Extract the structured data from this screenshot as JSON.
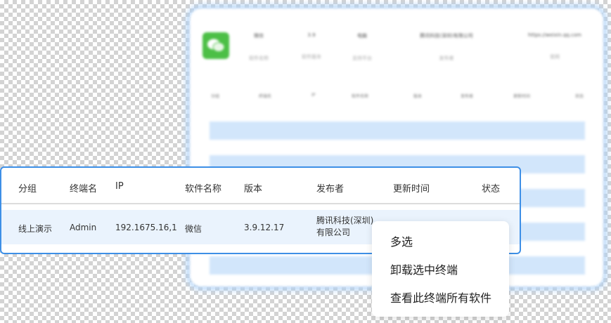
{
  "background_panel": {
    "info": [
      {
        "title": "微信",
        "sub": "软件名称"
      },
      {
        "title": "3.9",
        "sub": "软件版本"
      },
      {
        "title": "电脑",
        "sub": "支持平台"
      },
      {
        "title": "腾讯科技(深圳)有限公司",
        "sub": "发布者"
      },
      {
        "title": "https://weixin.qq.com",
        "sub": "官网"
      }
    ],
    "headers": [
      "分组",
      "终端名",
      "IP",
      "软件名称",
      "版本",
      "发布者",
      "更新时间",
      "状态"
    ]
  },
  "table": {
    "headers": [
      "分组",
      "终端名",
      "IP",
      "软件名称",
      "版本",
      "发布者",
      "更新时间",
      "状态"
    ],
    "rows": [
      {
        "group": "线上演示",
        "terminal": "Admin",
        "ip": "192.1675.16,1",
        "software": "微信",
        "version": "3.9.12.17",
        "publisher_line1": "腾讯科技(深圳)",
        "publisher_line2": "有限公司"
      }
    ]
  },
  "context_menu": {
    "items": [
      "多选",
      "卸载选中终端",
      "查看此终端所有软件"
    ]
  },
  "colors": {
    "accent": "#3d8fe6",
    "row_highlight": "#eaf3fd",
    "wechat_green": "#4cbf46"
  }
}
